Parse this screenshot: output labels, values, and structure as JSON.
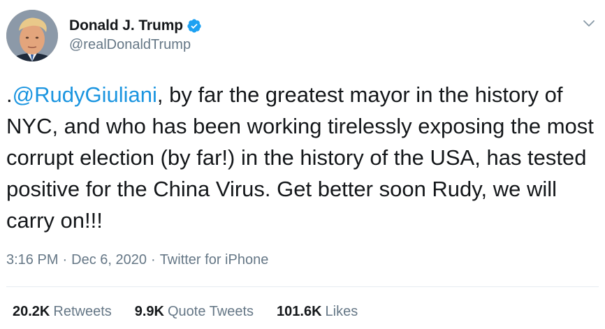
{
  "author": {
    "display_name": "Donald J. Trump",
    "handle": "@realDonaldTrump",
    "verified": true,
    "avatar_icon": "profile-photo"
  },
  "tweet": {
    "prefix": ".",
    "mention": "@RudyGiuliani",
    "body": ", by far the greatest mayor in the history of NYC, and who has been working tirelessly exposing the most corrupt election (by far!) in the history of the USA, has tested positive for the China Virus. Get better soon Rudy, we will carry on!!!"
  },
  "meta": {
    "time": "3:16 PM",
    "separator": "·",
    "date": "Dec 6, 2020",
    "source": "Twitter for iPhone"
  },
  "stats": {
    "retweets_count": "20.2K",
    "retweets_label": "Retweets",
    "quotes_count": "9.9K",
    "quotes_label": "Quote Tweets",
    "likes_count": "101.6K",
    "likes_label": "Likes"
  },
  "colors": {
    "link": "#1b95e0",
    "secondary_text": "#657786",
    "primary_text": "#14171a",
    "verified_badge": "#1da1f2",
    "divider": "#e6ecf0"
  }
}
